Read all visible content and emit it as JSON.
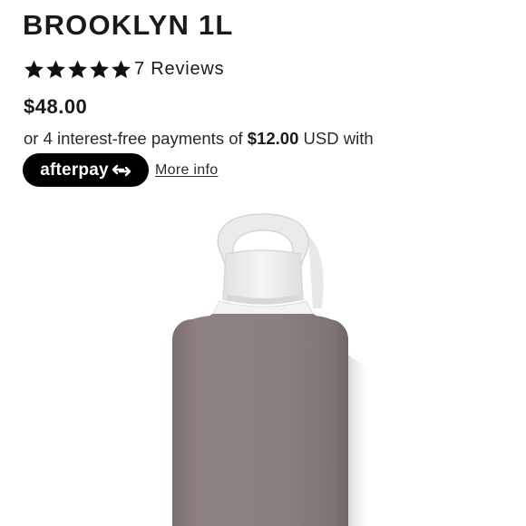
{
  "product": {
    "title": "BROOKLYN 1L",
    "rating_stars": 5,
    "reviews_label": "7 Reviews",
    "price": "$48.00"
  },
  "installments": {
    "prefix": "or 4 interest-free payments of",
    "amount": "$12.00",
    "currency": "USD",
    "suffix": "with"
  },
  "afterpay": {
    "logo_text": "afterpay",
    "logo_icon": "afterpay-arrows-icon",
    "more_info_label": "More info"
  },
  "colors": {
    "text": "#1a1a1a",
    "badge_bg": "#000000",
    "bottle_sleeve": "#8a7f7d",
    "bottle_cap": "#eeeeee"
  },
  "icons": {
    "star": "star-icon"
  }
}
